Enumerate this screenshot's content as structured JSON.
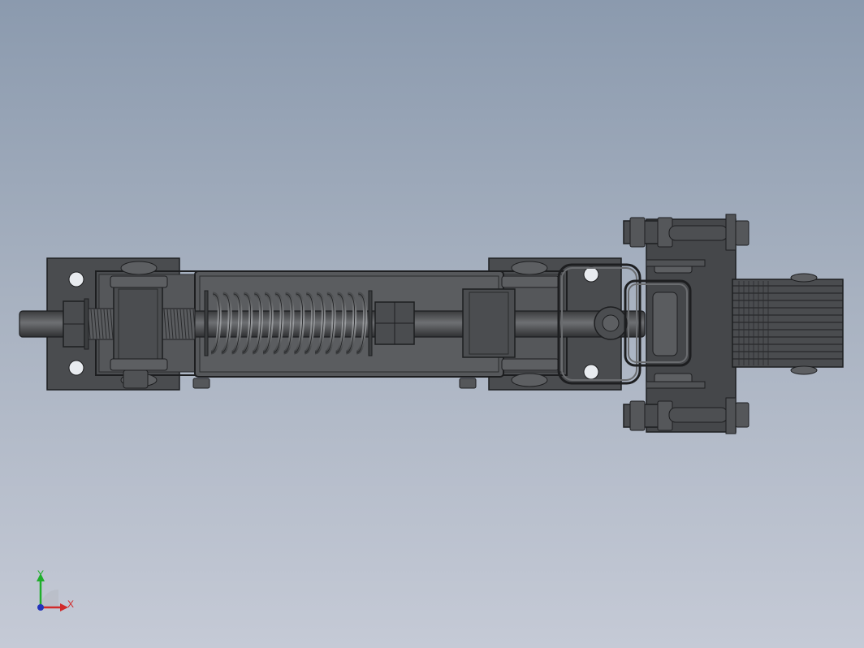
{
  "viewport": {
    "background_top": "#8b9aae",
    "background_bottom": "#c5cad6",
    "model_color": "#4a4c4f",
    "edge_color": "#1d1e20"
  },
  "triad": {
    "x_label": "X",
    "y_label": "Y",
    "x_color": "#d12a2a",
    "y_color": "#1fae2b",
    "z_color": "#2233bb"
  }
}
